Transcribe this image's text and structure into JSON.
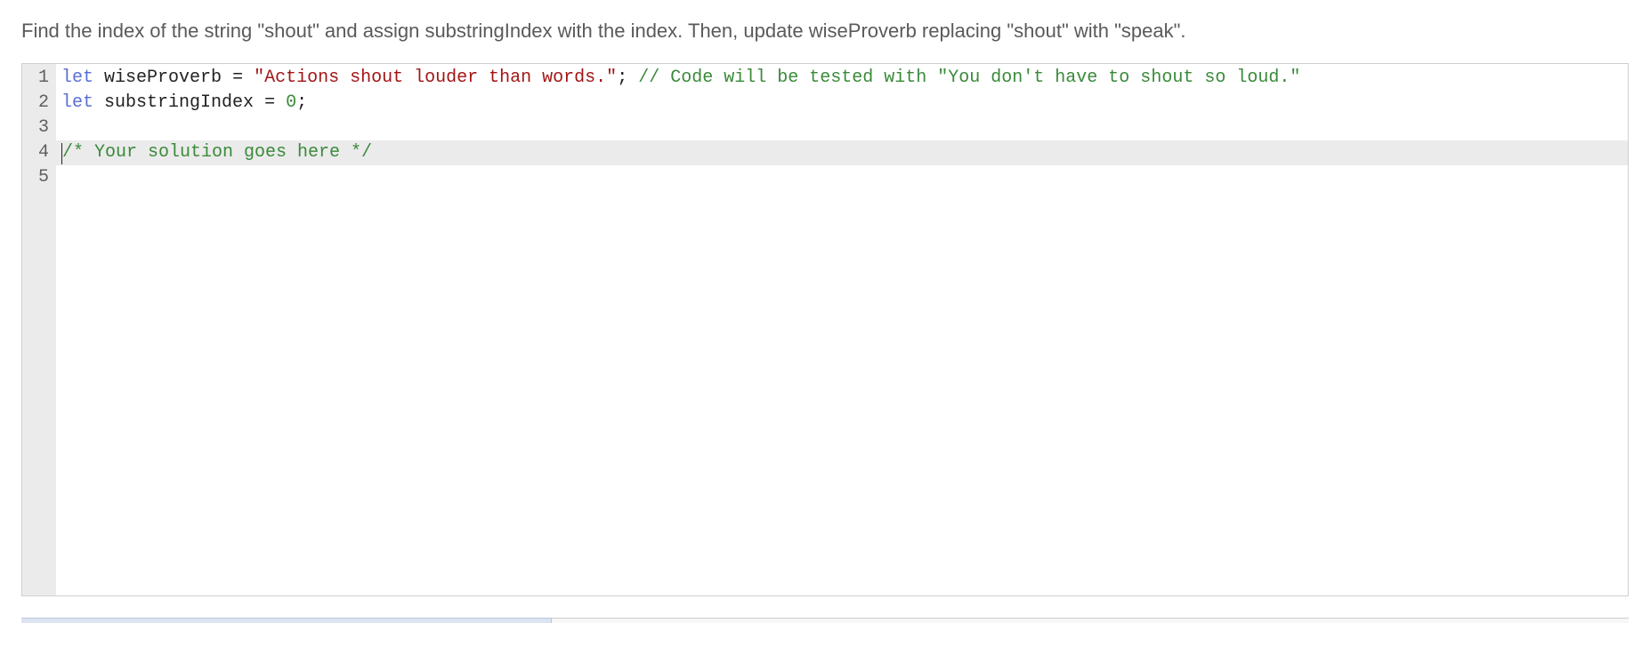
{
  "instruction": "Find the index of the string \"shout\" and assign substringIndex with the index. Then, update wiseProverb replacing \"shout\" with \"speak\".",
  "editor": {
    "lines": [
      {
        "num": "1",
        "highlight": false,
        "cursor": false,
        "tokens": [
          {
            "cls": "tok-keyword",
            "text": "let"
          },
          {
            "cls": "",
            "text": " "
          },
          {
            "cls": "tok-identifier",
            "text": "wiseProverb"
          },
          {
            "cls": "",
            "text": " "
          },
          {
            "cls": "tok-operator",
            "text": "="
          },
          {
            "cls": "",
            "text": " "
          },
          {
            "cls": "tok-string",
            "text": "\"Actions shout louder than words.\""
          },
          {
            "cls": "tok-punct",
            "text": ";"
          },
          {
            "cls": "",
            "text": " "
          },
          {
            "cls": "tok-comment",
            "text": "// Code will be tested with \"You don't have to shout so loud.\""
          }
        ]
      },
      {
        "num": "2",
        "highlight": false,
        "cursor": false,
        "tokens": [
          {
            "cls": "tok-keyword",
            "text": "let"
          },
          {
            "cls": "",
            "text": " "
          },
          {
            "cls": "tok-identifier",
            "text": "substringIndex"
          },
          {
            "cls": "",
            "text": " "
          },
          {
            "cls": "tok-operator",
            "text": "="
          },
          {
            "cls": "",
            "text": " "
          },
          {
            "cls": "tok-number",
            "text": "0"
          },
          {
            "cls": "tok-punct",
            "text": ";"
          }
        ]
      },
      {
        "num": "3",
        "highlight": false,
        "cursor": false,
        "tokens": []
      },
      {
        "num": "4",
        "highlight": true,
        "cursor": true,
        "tokens": [
          {
            "cls": "tok-comment",
            "text": "/* Your solution goes here */"
          }
        ]
      },
      {
        "num": "5",
        "highlight": false,
        "cursor": false,
        "tokens": []
      }
    ]
  }
}
